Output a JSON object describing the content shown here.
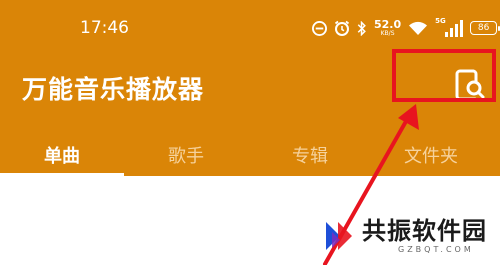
{
  "status_bar": {
    "time": "17:46",
    "net_speed": "52.0",
    "net_speed_unit": "KB/S",
    "network_type": "5G",
    "battery": "86"
  },
  "app": {
    "title": "万能音乐播放器"
  },
  "tabs": [
    {
      "label": "单曲",
      "active": true
    },
    {
      "label": "歌手",
      "active": false
    },
    {
      "label": "专辑",
      "active": false
    },
    {
      "label": "文件夹",
      "active": false
    }
  ],
  "watermark": {
    "name": "共振软件园",
    "domain": "GZBQT.COM"
  },
  "colors": {
    "appbar": "#DA8507",
    "highlight": "#E8141F",
    "tab_inactive": "#F6D29C"
  }
}
